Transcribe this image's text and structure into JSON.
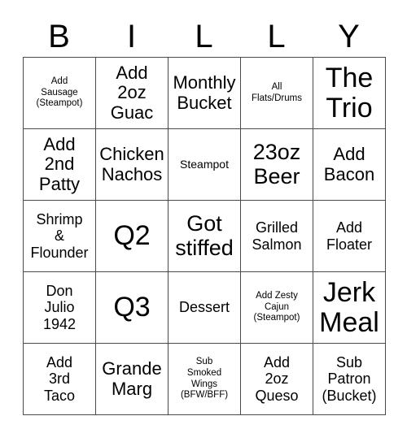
{
  "header": {
    "letters": [
      "B",
      "I",
      "L",
      "L",
      "Y"
    ]
  },
  "grid": {
    "columns": 5,
    "rows": 5,
    "border_color": "#4a4a4a",
    "background_color": "#ffffff",
    "text_color": "#000000",
    "cells": [
      {
        "text": "Add\nSausage\n(Steampot)",
        "size": "xs"
      },
      {
        "text": "Add\n2oz\nGuac",
        "size": "lg"
      },
      {
        "text": "Monthly\nBucket",
        "size": "lg"
      },
      {
        "text": "All\nFlats/Drums",
        "size": "xs"
      },
      {
        "text": "The\nTrio",
        "size": "xxl"
      },
      {
        "text": "Add\n2nd\nPatty",
        "size": "lg"
      },
      {
        "text": "Chicken\nNachos",
        "size": "lg"
      },
      {
        "text": "Steampot",
        "size": "sm"
      },
      {
        "text": "23oz\nBeer",
        "size": "xl"
      },
      {
        "text": "Add\nBacon",
        "size": "lg"
      },
      {
        "text": "Shrimp\n&\nFlounder",
        "size": "md"
      },
      {
        "text": "Q2",
        "size": "xxl"
      },
      {
        "text": "Got\nstiffed",
        "size": "xl"
      },
      {
        "text": "Grilled\nSalmon",
        "size": "md"
      },
      {
        "text": "Add\nFloater",
        "size": "md"
      },
      {
        "text": "Don\nJulio\n1942",
        "size": "md"
      },
      {
        "text": "Q3",
        "size": "xxl"
      },
      {
        "text": "Dessert",
        "size": "md"
      },
      {
        "text": "Add Zesty\nCajun\n(Steampot)",
        "size": "xs"
      },
      {
        "text": "Jerk\nMeal",
        "size": "xxl"
      },
      {
        "text": "Add\n3rd\nTaco",
        "size": "md"
      },
      {
        "text": "Grande\nMarg",
        "size": "lg"
      },
      {
        "text": "Sub\nSmoked\nWings\n(BFW/BFF)",
        "size": "xs"
      },
      {
        "text": "Add\n2oz\nQueso",
        "size": "md"
      },
      {
        "text": "Sub\nPatron\n(Bucket)",
        "size": "md"
      }
    ]
  }
}
